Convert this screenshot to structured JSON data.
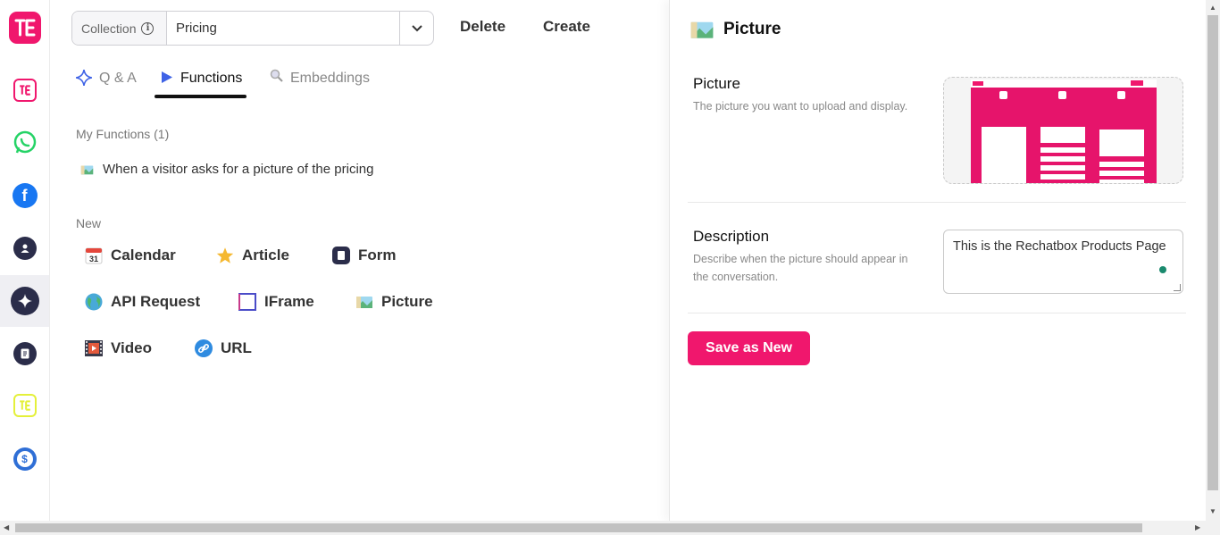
{
  "top": {
    "collection_label": "Collection",
    "collection_value": "Pricing",
    "delete_label": "Delete",
    "create_label": "Create"
  },
  "tabs": [
    {
      "label": "Q & A",
      "icon": "sparkle-icon"
    },
    {
      "label": "Functions",
      "icon": "play-icon",
      "active": true
    },
    {
      "label": "Embeddings",
      "icon": "search-icon"
    }
  ],
  "my_functions": {
    "heading": "My Functions (1)",
    "items": [
      {
        "label": "When a visitor asks for a picture of the pricing",
        "icon": "picture-icon"
      }
    ]
  },
  "new_section": {
    "heading": "New",
    "items": [
      {
        "label": "Calendar",
        "icon": "calendar-icon",
        "calendar_day": "31"
      },
      {
        "label": "Article",
        "icon": "star-icon"
      },
      {
        "label": "Form",
        "icon": "form-icon"
      },
      {
        "label": "API Request",
        "icon": "globe-icon"
      },
      {
        "label": "IFrame",
        "icon": "iframe-icon"
      },
      {
        "label": "Picture",
        "icon": "picture-icon"
      },
      {
        "label": "Video",
        "icon": "film-icon"
      },
      {
        "label": "URL",
        "icon": "link-icon"
      }
    ]
  },
  "panel": {
    "title": "Picture",
    "picture_title": "Picture",
    "picture_desc": "The picture you want to upload and display.",
    "description_title": "Description",
    "description_desc": "Describe when the picture should appear in the conversation.",
    "description_value": "This is the Rechatbox Products Page",
    "save_label": "Save as New"
  },
  "sidebar": [
    {
      "icon": "rechatbox-logo-icon"
    },
    {
      "icon": "rechatbox-icon"
    },
    {
      "icon": "whatsapp-icon"
    },
    {
      "icon": "facebook-icon"
    },
    {
      "icon": "contacts-icon"
    },
    {
      "icon": "ai-sparkle-icon",
      "active": true
    },
    {
      "icon": "form-icon"
    },
    {
      "icon": "rechatbox-yellow-icon"
    },
    {
      "icon": "billing-icon"
    }
  ],
  "colors": {
    "brand": "#f0176d",
    "dark": "#2b2d4a",
    "whatsapp": "#25d366",
    "facebook": "#1877f2",
    "yellow": "#e4f03a",
    "billing": "#2f6fd6"
  }
}
